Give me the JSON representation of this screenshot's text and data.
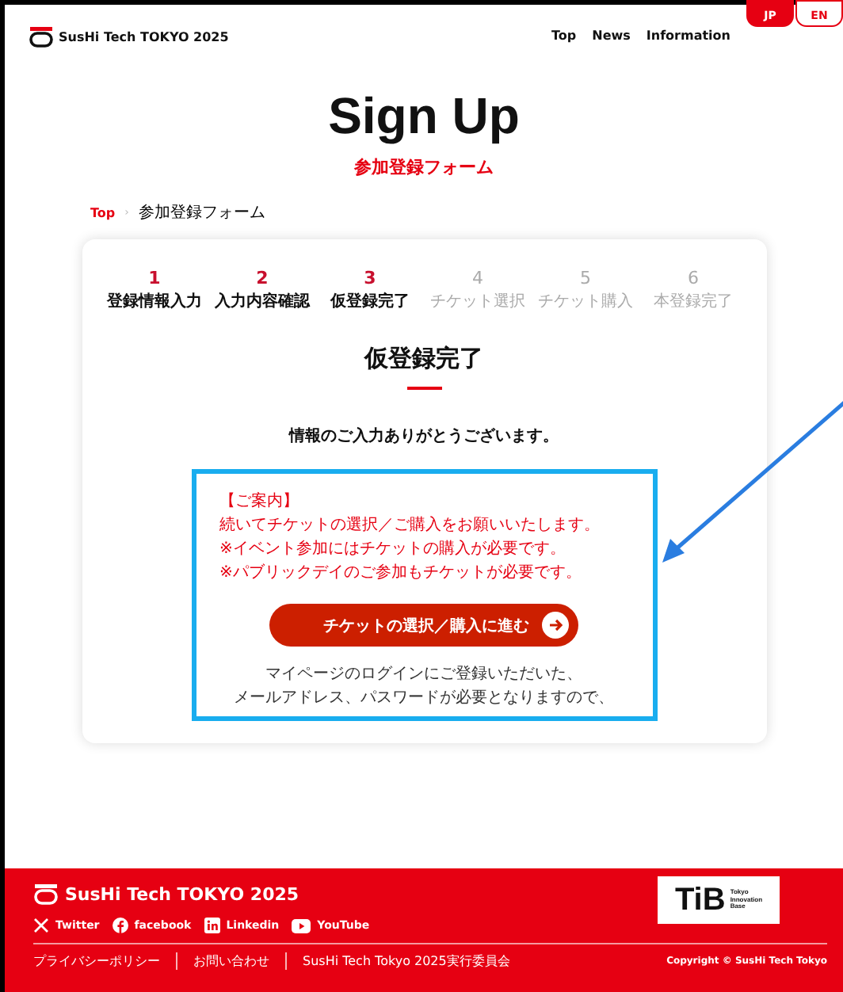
{
  "header": {
    "logo": "SusHi Tech TOKYO 2025",
    "nav": [
      "Top",
      "News",
      "Information"
    ],
    "languages": [
      {
        "label": "JP",
        "selected": true
      },
      {
        "label": "EN",
        "selected": false
      }
    ]
  },
  "title": "Sign Up",
  "subtitle": "参加登録フォーム",
  "breadcrumb": {
    "items": [
      "Top",
      "参加登録フォーム"
    ],
    "separator": "›"
  },
  "steps": [
    {
      "number": "1",
      "label": "登録情報入力",
      "reached": true
    },
    {
      "number": "2",
      "label": "入力内容確認",
      "reached": true
    },
    {
      "number": "3",
      "label": "仮登録完了",
      "reached": true
    },
    {
      "number": "4",
      "label": "チケット選択",
      "reached": false
    },
    {
      "number": "5",
      "label": "チケット購入",
      "reached": false
    },
    {
      "number": "6",
      "label": "本登録完了",
      "reached": false
    }
  ],
  "heading": "仮登録完了",
  "thanks": "情報のご入力ありがとうございます。",
  "notice": {
    "title": "【ご案内】",
    "lines": [
      "続いてチケットの選択／ご購入をお願いいたします。",
      "※イベント参加にはチケットの購入が必要です。",
      "※パブリックデイのご参加もチケットが必要です。"
    ]
  },
  "button": "チケットの選択／購入に進む",
  "note": [
    "マイページのログインにご登録いただいた、",
    "メールアドレス、パスワードが必要となりますので、"
  ],
  "footer": {
    "logo": "SusHi Tech TOKYO 2025",
    "social": [
      {
        "kind": "x",
        "label": "Twitter"
      },
      {
        "kind": "facebook",
        "label": "facebook"
      },
      {
        "kind": "linkedin",
        "label": "Linkedin"
      },
      {
        "kind": "youtube",
        "label": "YouTube"
      }
    ],
    "partner": {
      "name": "TiB",
      "sub": [
        "Tokyo",
        "Innovation",
        "Base"
      ]
    },
    "links": [
      "プライバシーポリシー",
      "お問い合わせ",
      "SusHi Tech Tokyo 2025実行委員会"
    ],
    "copyright": "Copyright © SusHi Tech Tokyo"
  }
}
